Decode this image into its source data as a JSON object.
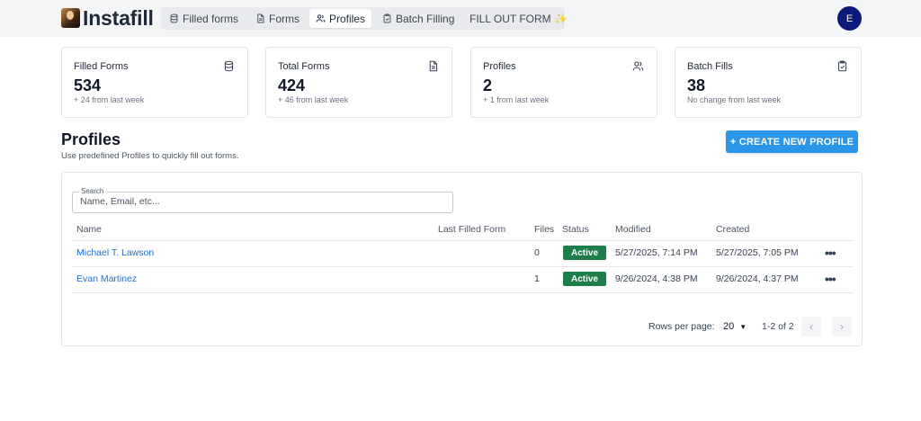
{
  "app": {
    "name": "Instafill"
  },
  "nav": {
    "filled_forms": "Filled forms",
    "forms": "Forms",
    "profiles": "Profiles",
    "batch_filling": "Batch Filling",
    "fill_out_form": "FILL OUT FORM ✨"
  },
  "user": {
    "initial": "E"
  },
  "stats": [
    {
      "title": "Filled Forms",
      "value": "534",
      "sub": "+ 24 from last week",
      "icon": "database-icon"
    },
    {
      "title": "Total Forms",
      "value": "424",
      "sub": "+ 46 from last week",
      "icon": "file-text-icon"
    },
    {
      "title": "Profiles",
      "value": "2",
      "sub": "+ 1 from last week",
      "icon": "users-icon"
    },
    {
      "title": "Batch Fills",
      "value": "38",
      "sub": "No change from last week",
      "icon": "clipboard-check-icon"
    }
  ],
  "page": {
    "title": "Profiles",
    "subtitle": "Use predefined Profiles to quickly fill out forms.",
    "create_button": "+ CREATE NEW PROFILE"
  },
  "search": {
    "label": "Search",
    "placeholder": "Name, Email, etc..."
  },
  "table": {
    "columns": [
      "Name",
      "Last Filled Form",
      "Files",
      "Status",
      "Modified",
      "Created"
    ],
    "rows": [
      {
        "name": "Michael T. Lawson",
        "last_filled": "",
        "files": "0",
        "status": "Active",
        "modified": "5/27/2025, 7:14 PM",
        "created": "5/27/2025, 7:05 PM"
      },
      {
        "name": "Evan Martinez",
        "last_filled": "",
        "files": "1",
        "status": "Active",
        "modified": "9/26/2024, 4:38 PM",
        "created": "9/26/2024, 4:37 PM"
      }
    ],
    "more_label": "•••"
  },
  "pagination": {
    "rows_per_page_label": "Rows per page:",
    "rows_per_page": "20",
    "range": "1-2 of 2",
    "prev": "‹",
    "next": "›"
  },
  "colors": {
    "primary": "#2b95e8",
    "active_badge": "#1e7e4a",
    "avatar": "#0c1a7a",
    "link": "#1f6fd6"
  }
}
